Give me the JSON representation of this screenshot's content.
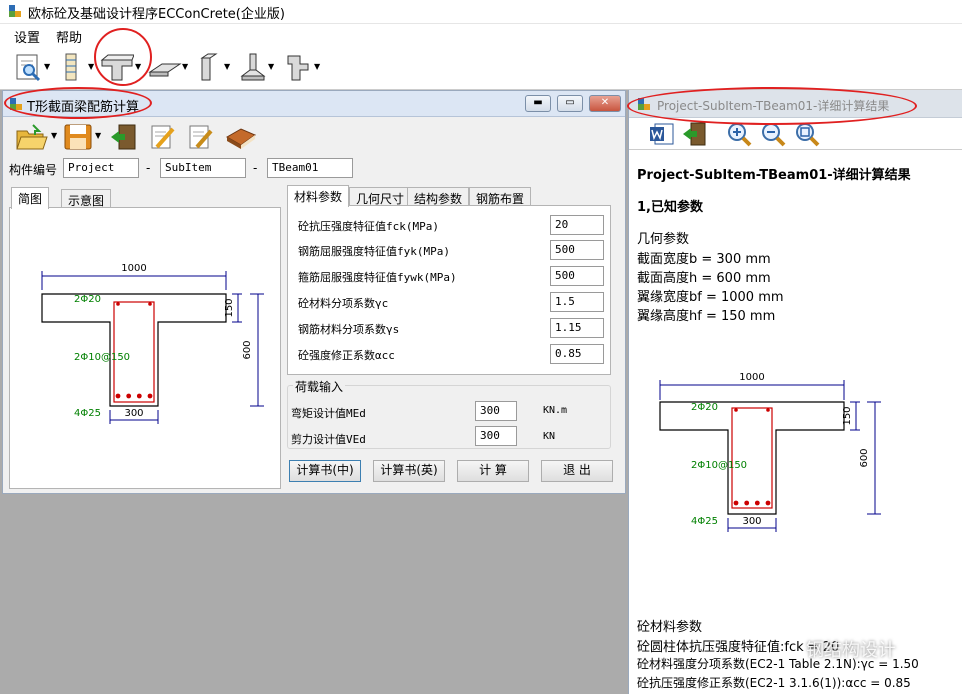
{
  "app": {
    "title": "欧标砼及基础设计程序ECConCrete(企业版)"
  },
  "menu": {
    "settings": "设置",
    "help": "帮助"
  },
  "tform": {
    "title": "T形截面梁配筋计算",
    "window_buttons": {
      "minimize": "▬",
      "maximize": "▭",
      "close": "✕"
    },
    "id_label": "构件编号",
    "dash": "-",
    "project": "Project",
    "subitem": "SubItem",
    "beam": "TBeam01",
    "left_tabs": [
      "简图",
      "示意图"
    ],
    "right_tabs": [
      "材料参数",
      "几何尺寸",
      "结构参数",
      "钢筋布置"
    ],
    "params": [
      {
        "label": "砼抗压强度特征值fck(MPa)",
        "value": "20"
      },
      {
        "label": "钢筋屈服强度特征值fyk(MPa)",
        "value": "500"
      },
      {
        "label": "箍筋屈服强度特征值fywk(MPa)",
        "value": "500"
      },
      {
        "label": "砼材料分项系数γc",
        "value": "1.5"
      },
      {
        "label": "钢筋材料分项系数γs",
        "value": "1.15"
      },
      {
        "label": "砼强度修正系数αcc",
        "value": "0.85"
      }
    ],
    "load_group": "荷载输入",
    "loads": [
      {
        "label": "弯矩设计值MEd",
        "value": "300",
        "unit": "KN.m"
      },
      {
        "label": "剪力设计值VEd",
        "value": "300",
        "unit": "KN"
      }
    ],
    "buttons": {
      "calc_cn": "计算书(中)",
      "calc_en": "计算书(英)",
      "calc": "计 算",
      "exit": "退 出"
    }
  },
  "sketch": {
    "bf": "1000",
    "hf": "150",
    "h": "600",
    "b": "300",
    "top_bar": "2Φ20",
    "stirrup": "2Φ10@150",
    "bottom_bar": "4Φ25"
  },
  "result": {
    "window_title": "Project-SubItem-TBeam01-详细计算结果",
    "heading": "Project-SubItem-TBeam01-详细计算结果",
    "section1": "1,已知参数",
    "geom_title": "几何参数",
    "geom": [
      "截面宽度b = 300 mm",
      "截面高度h = 600 mm",
      "翼缘宽度bf = 1000 mm",
      "翼缘高度hf = 150 mm"
    ],
    "mat_title": "砼材料参数",
    "mat": [
      "砼圆柱体抗压强度特征值:fck = 20",
      "砼材料强度分项系数(EC2-1 Table 2.1N):γc = 1.50",
      "砼抗压强度修正系数(EC2-1 3.1.6(1)):αcc = 0.85"
    ]
  },
  "watermark": "钢结构设计",
  "colors": {
    "annotation": "#e02020",
    "rebar": "#cc0000",
    "dim": "#00008b",
    "bar_text": "#008000"
  }
}
